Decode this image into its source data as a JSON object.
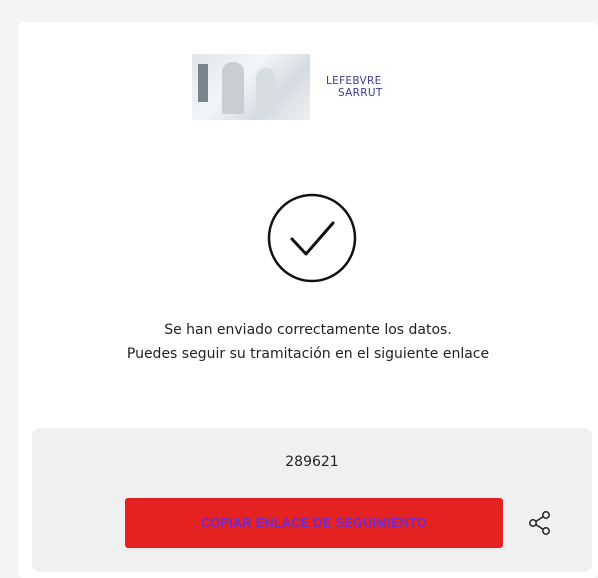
{
  "banner": {
    "logo_line1": "LEFEBVRE",
    "logo_line2": "SARRUT"
  },
  "status": {
    "icon": "check-circle-icon",
    "message_line1": "Se han enviado correctamente los datos.",
    "message_line2": "Puedes seguir su tramitación en el siguiente enlace"
  },
  "tracking": {
    "code": "289621",
    "copy_button_label": "COPIAR ENLACE DE SEGUIMIENTO",
    "share_icon": "share-icon"
  },
  "colors": {
    "button_bg": "#e52222",
    "button_text": "#6d2bd6",
    "panel_bg": "#f0f0f0",
    "logo_text": "#3b3f8f"
  }
}
